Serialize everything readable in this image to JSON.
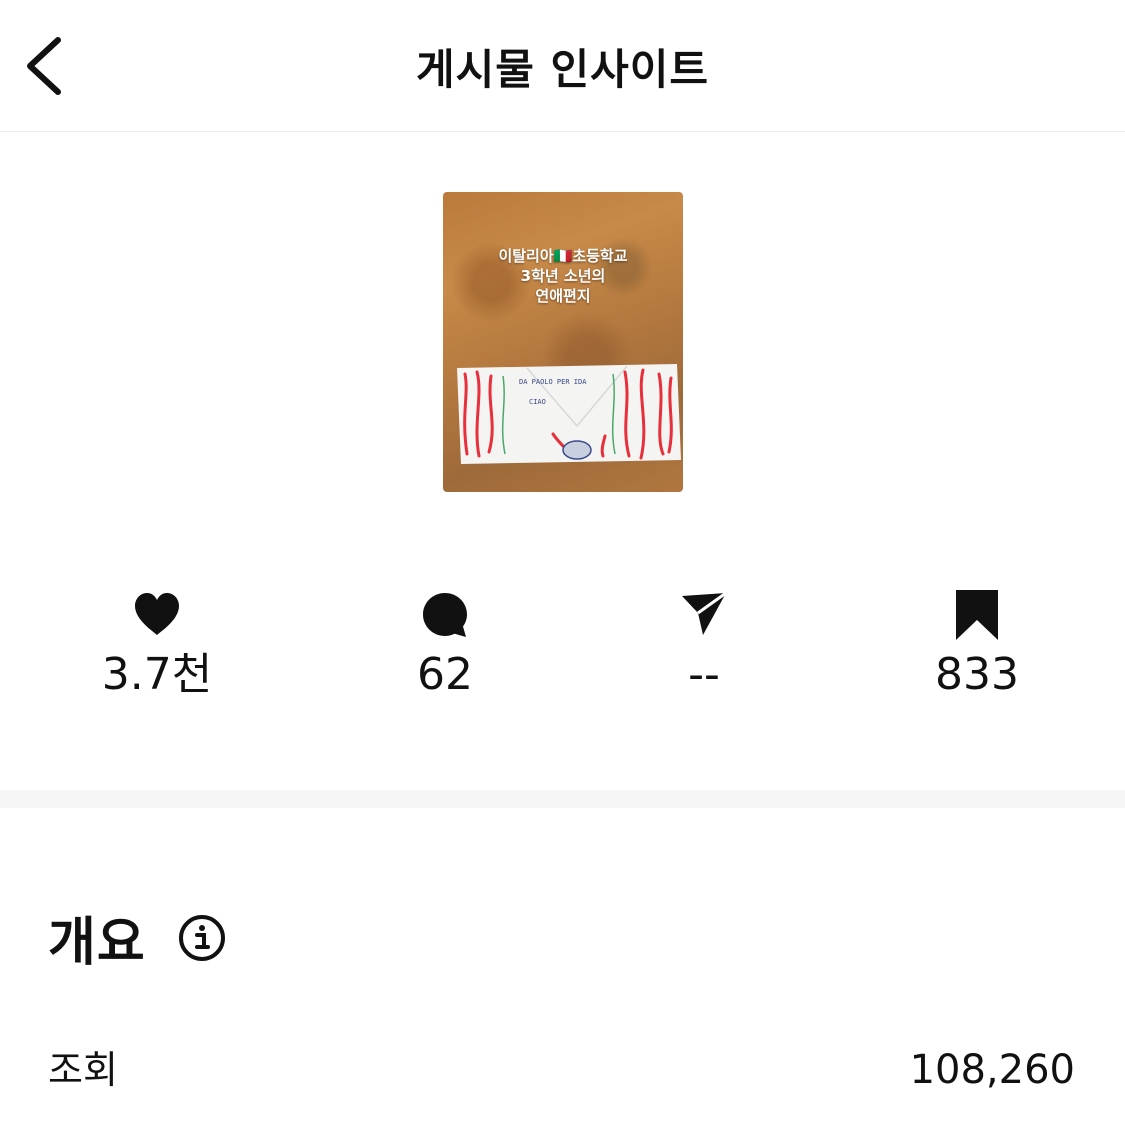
{
  "header": {
    "title": "게시물 인사이트",
    "back_icon": "chevron-left-icon"
  },
  "post": {
    "thumbnail_caption": [
      "이탈리아🇮🇹초등학교",
      "3학년 소년의",
      "연애편지"
    ],
    "envelope_text": [
      "DA PAOLO PER IDA",
      "CIAO"
    ]
  },
  "stats": [
    {
      "icon": "heart-icon",
      "value": "3.7천"
    },
    {
      "icon": "comment-icon",
      "value": "62"
    },
    {
      "icon": "share-icon",
      "value": "--"
    },
    {
      "icon": "bookmark-icon",
      "value": "833"
    }
  ],
  "overview": {
    "title": "개요",
    "info_icon": "info-icon",
    "rows": [
      {
        "label": "조회",
        "value": "108,260"
      }
    ]
  },
  "colors": {
    "text": "#111111",
    "divider": "#f6f6f6"
  }
}
